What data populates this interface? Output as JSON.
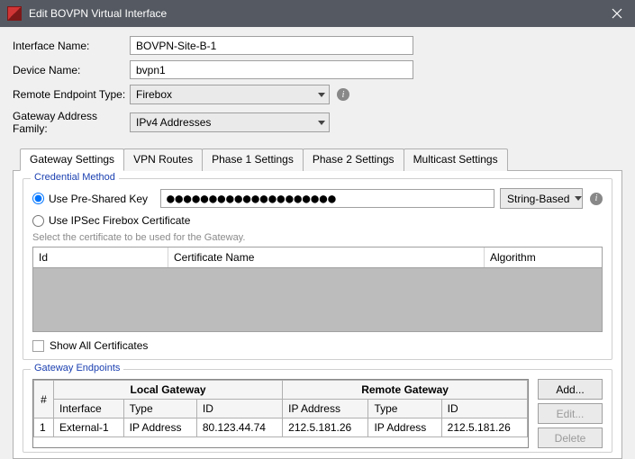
{
  "window": {
    "title": "Edit BOVPN Virtual Interface"
  },
  "form": {
    "interface_name_label": "Interface Name:",
    "interface_name_value": "BOVPN-Site-B-1",
    "device_name_label": "Device Name:",
    "device_name_value": "bvpn1",
    "remote_endpoint_label": "Remote Endpoint Type:",
    "remote_endpoint_value": "Firebox",
    "gateway_family_label": "Gateway Address Family:",
    "gateway_family_value": "IPv4 Addresses"
  },
  "tabs": {
    "gateway": "Gateway Settings",
    "vpn_routes": "VPN Routes",
    "phase1": "Phase 1 Settings",
    "phase2": "Phase 2 Settings",
    "multicast": "Multicast Settings"
  },
  "credential": {
    "legend": "Credential Method",
    "psk_radio": "Use Pre-Shared Key",
    "psk_value": "●●●●●●●●●●●●●●●●●●●●",
    "psk_type": "String-Based",
    "cert_radio": "Use IPSec Firebox Certificate",
    "hint": "Select the certificate to be used for the Gateway.",
    "cert_cols": {
      "id": "Id",
      "name": "Certificate Name",
      "alg": "Algorithm"
    },
    "show_all": "Show All Certificates"
  },
  "endpoints": {
    "legend": "Gateway Endpoints",
    "num_col": "#",
    "local": "Local Gateway",
    "remote": "Remote Gateway",
    "cols": {
      "iface": "Interface",
      "type": "Type",
      "id": "ID",
      "ip": "IP Address"
    },
    "row": {
      "num": "1",
      "iface": "External-1",
      "ltype": "IP Address",
      "lid": "80.123.44.74",
      "rip": "212.5.181.26",
      "rtype": "IP Address",
      "rid": "212.5.181.26"
    },
    "buttons": {
      "add": "Add...",
      "edit": "Edit...",
      "delete": "Delete"
    }
  }
}
